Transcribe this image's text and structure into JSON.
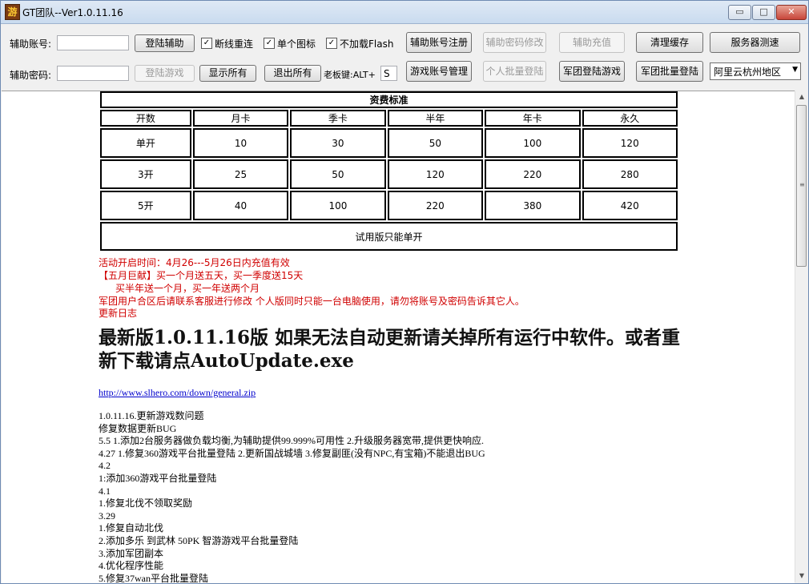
{
  "window": {
    "title": "GT团队--Ver1.0.11.16",
    "icon_char": "游",
    "minimize": "▭",
    "maximize": "□",
    "close": "✕"
  },
  "toolbar": {
    "account_label": "辅助账号:",
    "account_value": "",
    "password_label": "辅助密码:",
    "password_value": "",
    "login_assist": "登陆辅助",
    "login_game": "登陆游戏",
    "chk_reconnect": "断线重连",
    "chk_single_icon": "单个图标",
    "chk_no_flash": "不加载Flash",
    "show_all": "显示所有",
    "exit_all": "退出所有",
    "boss_key_label": "老板键:ALT+",
    "boss_key_value": "S",
    "register": "辅助账号注册",
    "change_password": "辅助密码修改",
    "recharge": "辅助充值",
    "clear_cache": "清理缓存",
    "server_test": "服务器测速",
    "game_account_mgr": "游戏账号管理",
    "batch_login_personal": "个人批量登陆",
    "group_login_game": "军团登陆游戏",
    "group_batch_login": "军团批量登陆",
    "region_selected": "阿里云杭州地区"
  },
  "price_table": {
    "title": "资费标准",
    "headers": [
      "开数",
      "月卡",
      "季卡",
      "半年",
      "年卡",
      "永久"
    ],
    "rows": [
      [
        "单开",
        "10",
        "30",
        "50",
        "100",
        "120"
      ],
      [
        "3开",
        "25",
        "50",
        "120",
        "220",
        "280"
      ],
      [
        "5开",
        "40",
        "100",
        "220",
        "380",
        "420"
      ]
    ],
    "trial_note": "试用版只能单开"
  },
  "notices": {
    "line1": "活动开启时间：4月26---5月26日内充值有效",
    "line2": "【五月巨献】买一个月送五天，买一季度送15天",
    "line3": "买半年送一个月，买一年送两个月",
    "line4": "军团用户合区后请联系客服进行修改  个人版同时只能一台电脑使用，请勿将账号及密码告诉其它人。",
    "line5": "更新日志"
  },
  "headline": "最新版1.0.11.16版  如果无法自动更新请关掉所有运行中软件。或者重新下载请点AutoUpdate.exe",
  "download_link": "http://www.slhero.com/down/general.zip",
  "changelog": [
    "1.0.11.16.更新游戏数问题",
    "修复数据更新BUG",
    "5.5 1.添加2台服务器做负载均衡,为辅助提供99.999%可用性  2.升级服务器宽带,提供更快响应.",
    "4.27 1.修复360游戏平台批量登陆  2.更新国战城墙  3.修复副匪(没有NPC,有宝箱)不能退出BUG",
    "4.2",
    "1:添加360游戏平台批量登陆",
    "4.1",
    "1.修复北伐不领取奖励",
    "3.29",
    "1.修复自动北伐",
    "2.添加多乐  到武林  50PK 智游游戏平台批量登陆",
    "3.添加军团副本",
    "4.优化程序性能",
    "5.修复37wan平台批量登陆"
  ],
  "scrollbar": {
    "up": "▲",
    "down": "▼",
    "grip": "≡"
  },
  "colors": {
    "notice_red": "#d00000",
    "link_blue": "#0000cc"
  }
}
